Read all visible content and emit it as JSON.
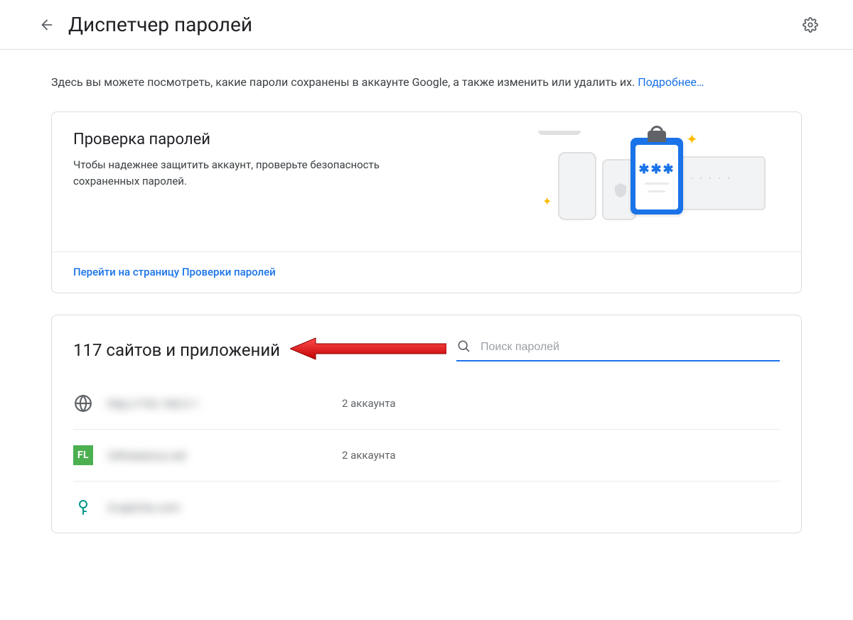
{
  "header": {
    "title": "Диспетчер паролей"
  },
  "intro": {
    "text": "Здесь вы можете посмотреть, какие пароли сохранены в аккаунте Google, а также изменить или удалить их. ",
    "more_label": "Подробнее…"
  },
  "checkup": {
    "title": "Проверка паролей",
    "desc": "Чтобы надежнее защитить аккаунт, проверьте безопасность сохраненных паролей.",
    "action_label": "Перейти на страницу Проверки паролей",
    "clipboard_stars": "✱✱✱"
  },
  "list": {
    "count_title": "117 сайтов и приложений",
    "search_placeholder": "Поиск паролей",
    "items": [
      {
        "name": "http://192.168.0.1",
        "accounts": "2 аккаунта",
        "icon": "globe"
      },
      {
        "name": "24freelance.net",
        "accounts": "2 аккаунта",
        "icon": "fl"
      },
      {
        "name": "2captcha.com",
        "accounts": "",
        "icon": "key"
      }
    ]
  }
}
